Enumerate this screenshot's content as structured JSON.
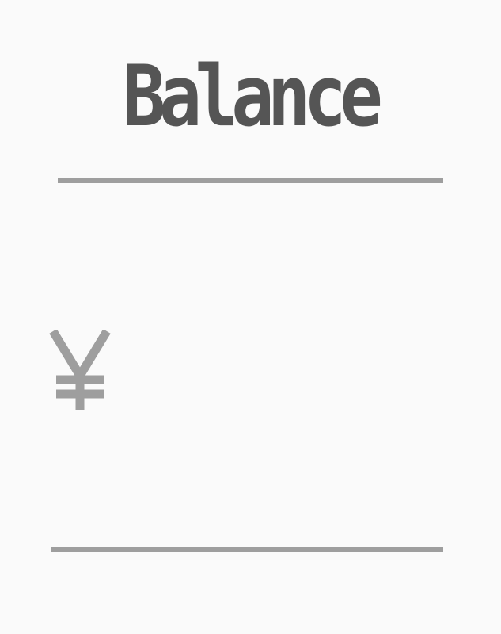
{
  "header": {
    "title": "Balance"
  },
  "balance": {
    "currency_icon": "yen-icon",
    "amount": ""
  },
  "colors": {
    "background": "#fafafa",
    "title": "#555555",
    "divider": "#9e9e9e",
    "currency": "#9e9e9e"
  }
}
